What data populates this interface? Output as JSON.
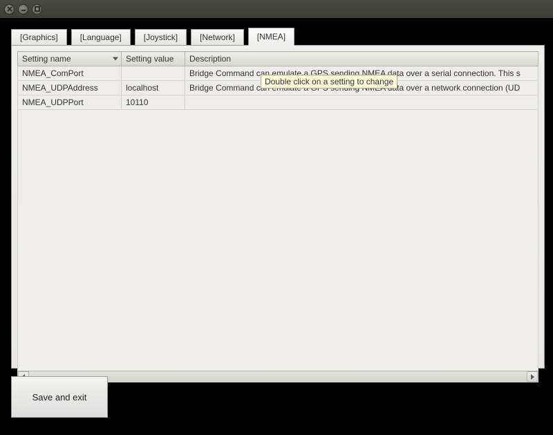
{
  "titlebar": {
    "buttons": [
      "close",
      "minimize",
      "maximize"
    ]
  },
  "tabs": [
    {
      "label": "[Graphics]",
      "active": false
    },
    {
      "label": "[Language]",
      "active": false
    },
    {
      "label": "[Joystick]",
      "active": false
    },
    {
      "label": "[Network]",
      "active": false
    },
    {
      "label": "[NMEA]",
      "active": true
    }
  ],
  "columns": {
    "name": "Setting name",
    "value": "Setting value",
    "description": "Description"
  },
  "rows": [
    {
      "name": "NMEA_ComPort",
      "value": "",
      "description": "Bridge Command can emulate a GPS sending NMEA data over a serial connection. This s"
    },
    {
      "name": "NMEA_UDPAddress",
      "value": "localhost",
      "description": "Bridge Command can emulate a GPS sending NMEA data over a network connection (UD"
    },
    {
      "name": "NMEA_UDPPort",
      "value": "10110",
      "description": ""
    }
  ],
  "tooltip": "Double click on a setting to change",
  "buttons": {
    "save": "Save and exit"
  }
}
